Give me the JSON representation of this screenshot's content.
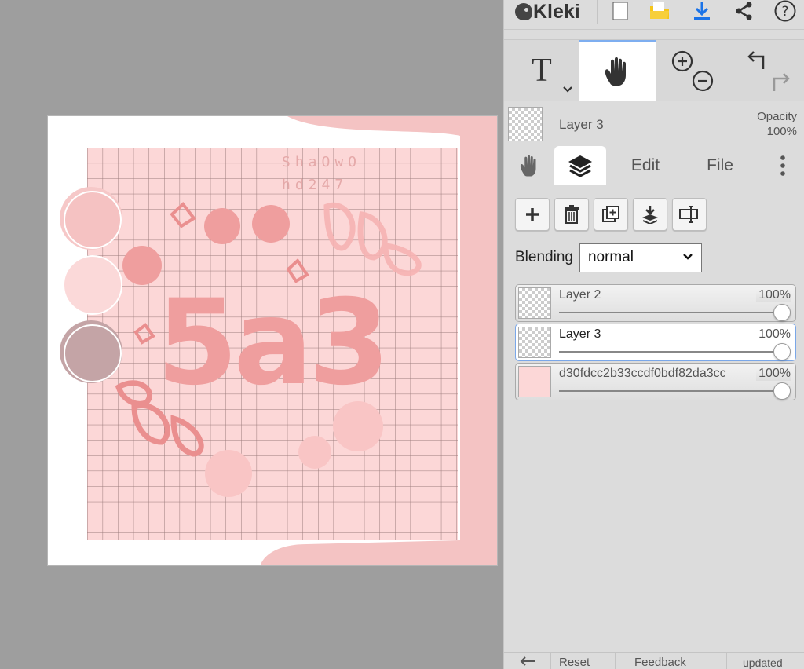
{
  "app": {
    "name": "Kleki"
  },
  "toolbar": {
    "buttons": [
      {
        "name": "new-image",
        "icon": "new-page-icon"
      },
      {
        "name": "open",
        "icon": "open-folder-icon",
        "color": "#f5c518"
      },
      {
        "name": "save",
        "icon": "download-icon",
        "color": "#1b73e8"
      },
      {
        "name": "share",
        "icon": "share-icon"
      },
      {
        "name": "help",
        "icon": "help-icon"
      }
    ]
  },
  "tools": {
    "text_tool_label": "T",
    "items": [
      {
        "name": "text-tool",
        "icon": "text-tool-icon",
        "active": false
      },
      {
        "name": "hand-tool",
        "icon": "hand-icon",
        "active": true
      },
      {
        "name": "zoom",
        "icon": "zoom-in-out-icon"
      },
      {
        "name": "undo-redo",
        "icon": "undo-redo-icon"
      }
    ]
  },
  "current_layer": {
    "name": "Layer 3",
    "opacity_label": "Opacity",
    "opacity_value": "100%"
  },
  "tabs": [
    {
      "name": "hand",
      "icon": "hand-icon",
      "active": false
    },
    {
      "name": "layers",
      "icon": "layers-icon",
      "active": true
    },
    {
      "name": "edit",
      "label": "Edit",
      "active": false
    },
    {
      "name": "file",
      "label": "File",
      "active": false
    },
    {
      "name": "more",
      "icon": "more-vertical-icon",
      "active": false
    }
  ],
  "layer_actions": [
    {
      "name": "add-layer",
      "icon": "plus-icon"
    },
    {
      "name": "delete-layer",
      "icon": "trash-icon"
    },
    {
      "name": "duplicate-layer",
      "icon": "duplicate-icon"
    },
    {
      "name": "merge-down",
      "icon": "merge-down-icon"
    },
    {
      "name": "rename-layer",
      "icon": "rename-icon"
    }
  ],
  "blending": {
    "label": "Blending",
    "value": "normal"
  },
  "layers": [
    {
      "name": "Layer 2",
      "opacity": "100%",
      "opacity_value": 1.0,
      "selected": false
    },
    {
      "name": "Layer 3",
      "opacity": "100%",
      "opacity_value": 1.0,
      "selected": true
    },
    {
      "name": "d30fdcc2b33ccdf0bdf82da3cc",
      "opacity": "100%",
      "opacity_value": 1.0,
      "selected": false
    }
  ],
  "artwork": {
    "main_text": "5a3",
    "small_text_line1": "ShaOwO",
    "small_text_line2": "hd247",
    "colors": {
      "background": "#ffffff",
      "grid_fill": "#fcd7d7",
      "grid_line": "#8a6b6b",
      "accent": "#f2a7a7",
      "deep": "#ef8f8f",
      "mauve": "#c4a4a6"
    }
  },
  "bottom_bar": {
    "items": [
      "",
      "Reset",
      "Feedback",
      "updated"
    ]
  }
}
